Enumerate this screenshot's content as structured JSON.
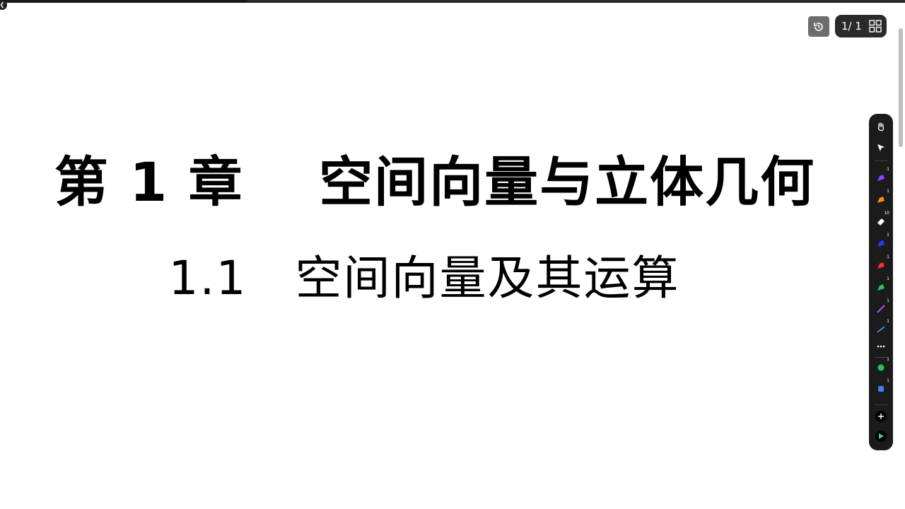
{
  "slide": {
    "chapter_title": "第 1 章　 空间向量与立体几何",
    "section_title": "1.1　空间向量及其运算"
  },
  "pager": {
    "current": "1",
    "separator": "/",
    "total": "1",
    "label": "1/ 1"
  },
  "toolbar": {
    "tools": [
      {
        "name": "hand-icon"
      },
      {
        "name": "pointer-icon"
      },
      {
        "name": "purple-pen-icon",
        "badge": "1",
        "color": "#8e44ff"
      },
      {
        "name": "orange-highlighter-icon",
        "badge": "1",
        "color": "#ff8c1a"
      },
      {
        "name": "eraser-icon",
        "badge": "10"
      },
      {
        "name": "blue-pen-icon",
        "badge": "1",
        "color": "#1e3cff"
      },
      {
        "name": "red-pen-icon",
        "badge": "1",
        "color": "#ff2d2d"
      },
      {
        "name": "green-pen-icon",
        "badge": "1",
        "color": "#22c55e"
      },
      {
        "name": "laser-pen-icon",
        "badge": "1",
        "color": "#a855f7"
      },
      {
        "name": "line-tool-icon",
        "badge": "1",
        "color": "#3b82f6"
      },
      {
        "name": "more-icon"
      },
      {
        "name": "circle-shape-icon",
        "badge": "1",
        "color": "#22c55e"
      },
      {
        "name": "square-shape-icon",
        "badge": "1",
        "color": "#3b82f6"
      },
      {
        "name": "add-icon"
      },
      {
        "name": "play-icon"
      }
    ]
  }
}
